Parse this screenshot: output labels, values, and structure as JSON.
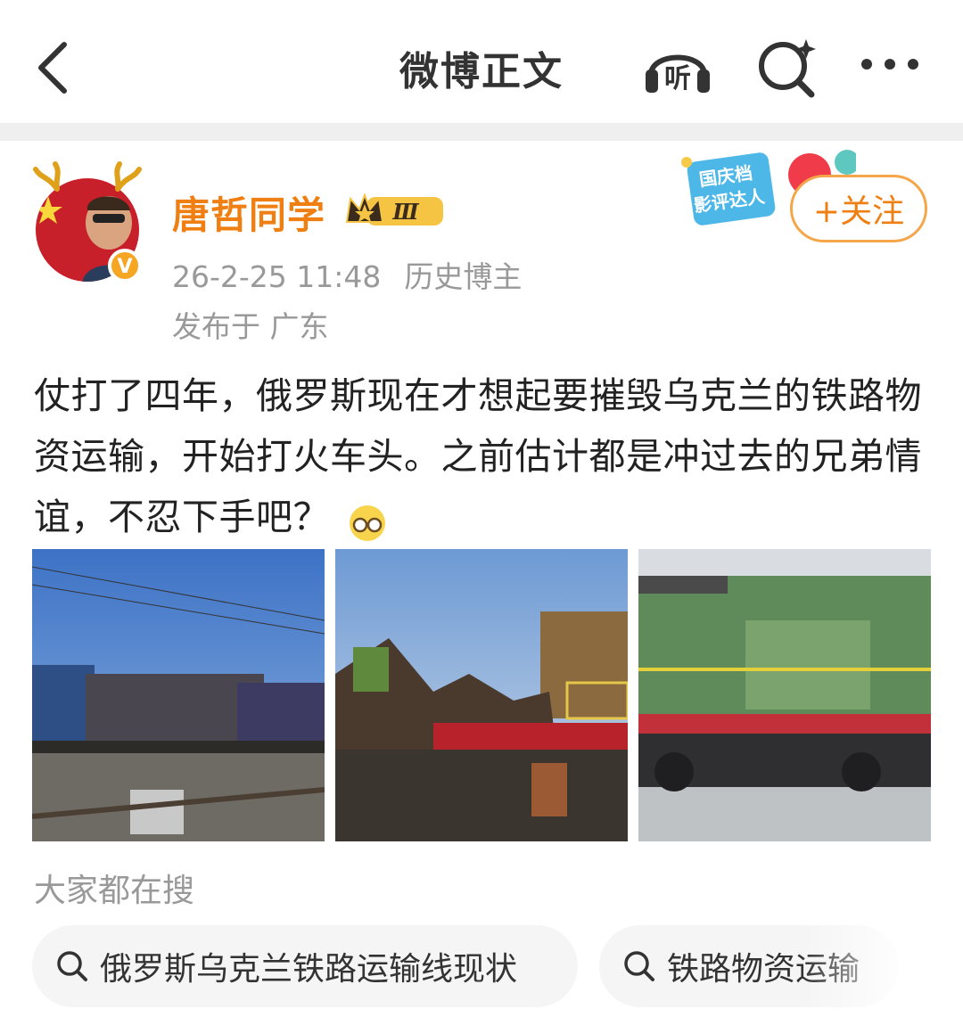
{
  "header": {
    "title": "微博正文",
    "back_icon": "chevron-left-icon",
    "listen_label": "听",
    "search_icon": "search-sparkle-icon",
    "more_icon": "more-dots-icon"
  },
  "post": {
    "author": {
      "name": "唐哲同学",
      "level_badge": "Ⅲ",
      "verified_mark": "V"
    },
    "timestamp": "26-2-25 11:48",
    "author_tag": "历史博主",
    "location": "发布于 广东",
    "promo_badge": {
      "line1": "国庆档",
      "line2": "影评达人"
    },
    "follow_label": "+关注",
    "text": "仗打了四年，俄罗斯现在才想起要摧毁乌克兰的铁路物资运输，开始打火车头。之前估计都是冲过去的兄弟情谊，不忍下手吧？",
    "images": [
      {
        "name": "photo-1",
        "subject": "damaged-locomotive-blue-sky"
      },
      {
        "name": "photo-2",
        "subject": "wrecked-locomotive-front"
      },
      {
        "name": "photo-3",
        "subject": "green-locomotive-damaged"
      }
    ]
  },
  "search_section": {
    "label": "大家都在搜",
    "chips": [
      {
        "text": "俄罗斯乌克兰铁路运输线现状"
      },
      {
        "text": "铁路物资运输"
      }
    ]
  },
  "colors": {
    "accent_orange": "#f07f13",
    "follow_border": "#f5a64a",
    "muted_text": "#999999",
    "divider": "#efefef",
    "chip_bg": "#f5f5f5"
  }
}
